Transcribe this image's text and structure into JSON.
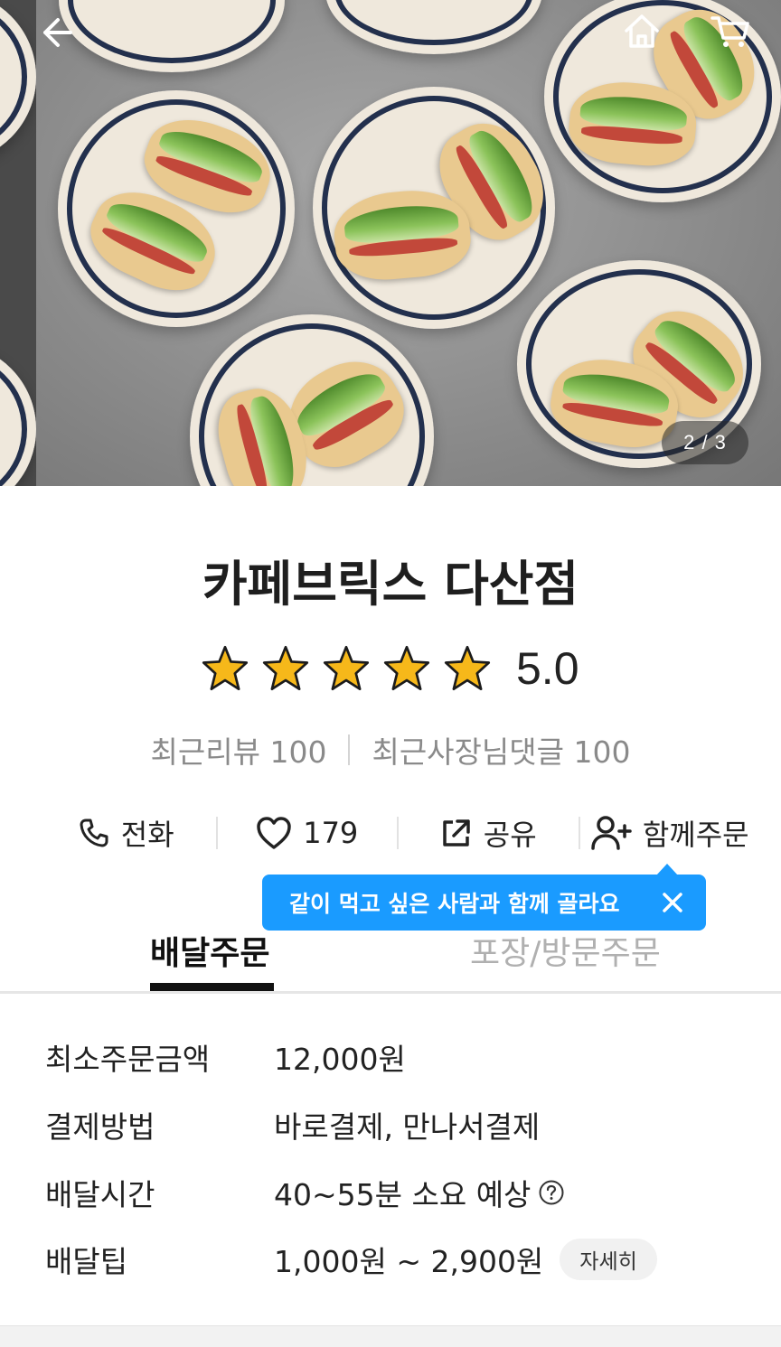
{
  "hero": {
    "pager": "2 / 3",
    "image_alt": "sandwiches on plates",
    "icons": {
      "back": "back-arrow-icon",
      "home": "home-icon",
      "cart": "cart-icon"
    }
  },
  "store": {
    "name": "카페브릭스 다산점",
    "rating_value": "5.0",
    "rating_stars": 5,
    "recent_reviews": "최근리뷰 100",
    "owner_replies": "최근사장님댓글 100"
  },
  "actions": {
    "call": "전화",
    "like_count": "179",
    "share": "공유",
    "group_order": "함께주문"
  },
  "tooltip": {
    "text": "같이 먹고 싶은 사람과 함께 골라요"
  },
  "tabs": {
    "delivery": "배달주문",
    "pickup": "포장/방문주문"
  },
  "info": {
    "min_order_label": "최소주문금액",
    "min_order_value": "12,000원",
    "payment_label": "결제방법",
    "payment_value": "바로결제, 만나서결제",
    "delivery_time_label": "배달시간",
    "delivery_time_value": "40~55분 소요 예상",
    "delivery_tip_label": "배달팁",
    "delivery_tip_value": "1,000원 ~ 2,900원",
    "detail_button": "자세히"
  },
  "colors": {
    "accent_blue": "#1a9bff",
    "star_gold": "#f6b81a",
    "text_dark": "#222222",
    "text_muted": "#8a8a8a"
  }
}
